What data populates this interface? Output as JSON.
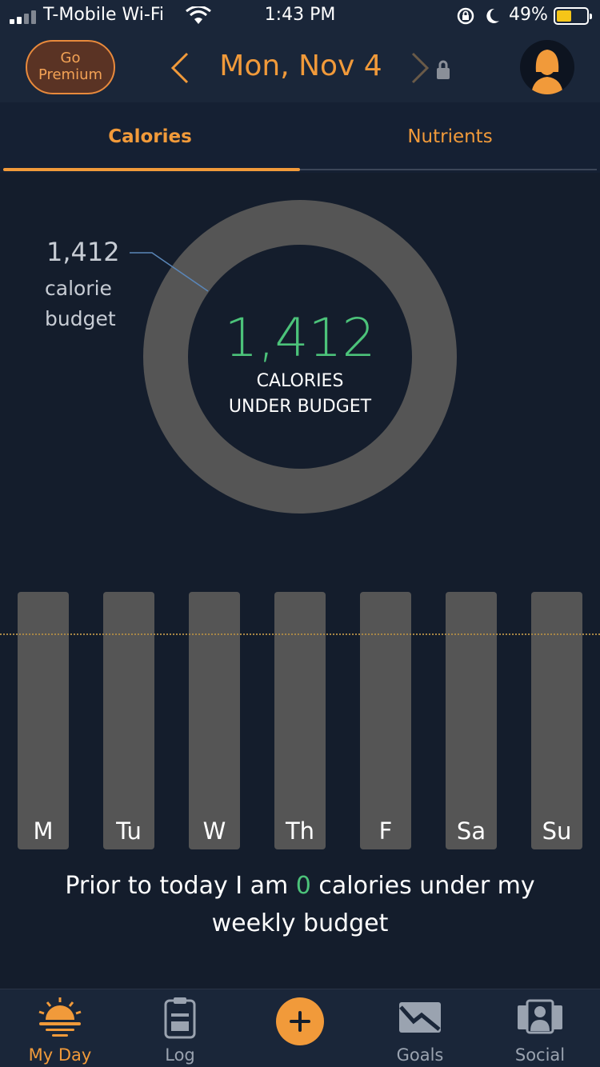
{
  "status_bar": {
    "carrier": "T-Mobile Wi-Fi",
    "time": "1:43 PM",
    "battery": "49%",
    "battery_level": 0.49,
    "icons": [
      "signal-icon",
      "wifi-icon",
      "rotation-lock-icon",
      "moon-icon",
      "battery-icon"
    ]
  },
  "header": {
    "premium_line1": "Go",
    "premium_line2": "Premium",
    "date": "Mon, Nov 4",
    "icons": [
      "chevron-left-icon",
      "chevron-right-icon",
      "lock-icon",
      "avatar-icon"
    ]
  },
  "tabs": [
    {
      "label": "Calories",
      "active": true
    },
    {
      "label": "Nutrients",
      "active": false
    }
  ],
  "ring": {
    "value": "1,412",
    "caption_line1": "CALORIES",
    "caption_line2": "UNDER BUDGET",
    "budget_value": "1,412",
    "budget_line1": "calorie",
    "budget_line2": "budget"
  },
  "week": {
    "days": [
      "M",
      "Tu",
      "W",
      "Th",
      "F",
      "Sa",
      "Su"
    ]
  },
  "summary": {
    "prefix": "Prior to today I am ",
    "value": "0",
    "suffix": " calories under my weekly budget"
  },
  "tabbar": [
    {
      "label": "My Day",
      "icon": "sunrise-icon",
      "active": true
    },
    {
      "label": "Log",
      "icon": "clipboard-icon",
      "active": false
    },
    {
      "label": "",
      "icon": "plus-icon",
      "active": false
    },
    {
      "label": "Goals",
      "icon": "envelope-chart-icon",
      "active": false
    },
    {
      "label": "Social",
      "icon": "people-icon",
      "active": false
    }
  ],
  "colors": {
    "accent": "#f19a3a",
    "positive": "#4cc37a",
    "background": "#141d2c",
    "bar": "#555555"
  }
}
